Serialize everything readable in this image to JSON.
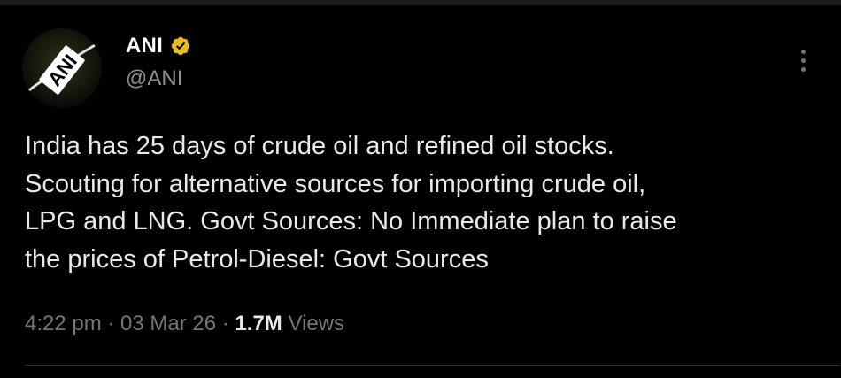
{
  "author": {
    "display_name": "ANI",
    "handle": "@ANI",
    "verified": true,
    "verified_color": "#e8b923",
    "avatar_logo_text": "ANI",
    "avatar_icon": "ani-logo-icon"
  },
  "more_icon": "more-dots-icon",
  "tweet": {
    "text": "India has 25 days of crude oil and refined oil stocks.\nScouting for alternative sources for importing crude oil,\nLPG and LNG. Govt Sources: No Immediate plan to raise\nthe prices of Petrol-Diesel: Govt Sources"
  },
  "meta": {
    "time": "4:22 pm",
    "separator": " · ",
    "date": "03 Mar 26",
    "views_count": "1.7M",
    "views_label": "Views"
  },
  "colors": {
    "background": "#000000",
    "primary_text": "#e7e9ea",
    "secondary_text": "#71767b"
  }
}
